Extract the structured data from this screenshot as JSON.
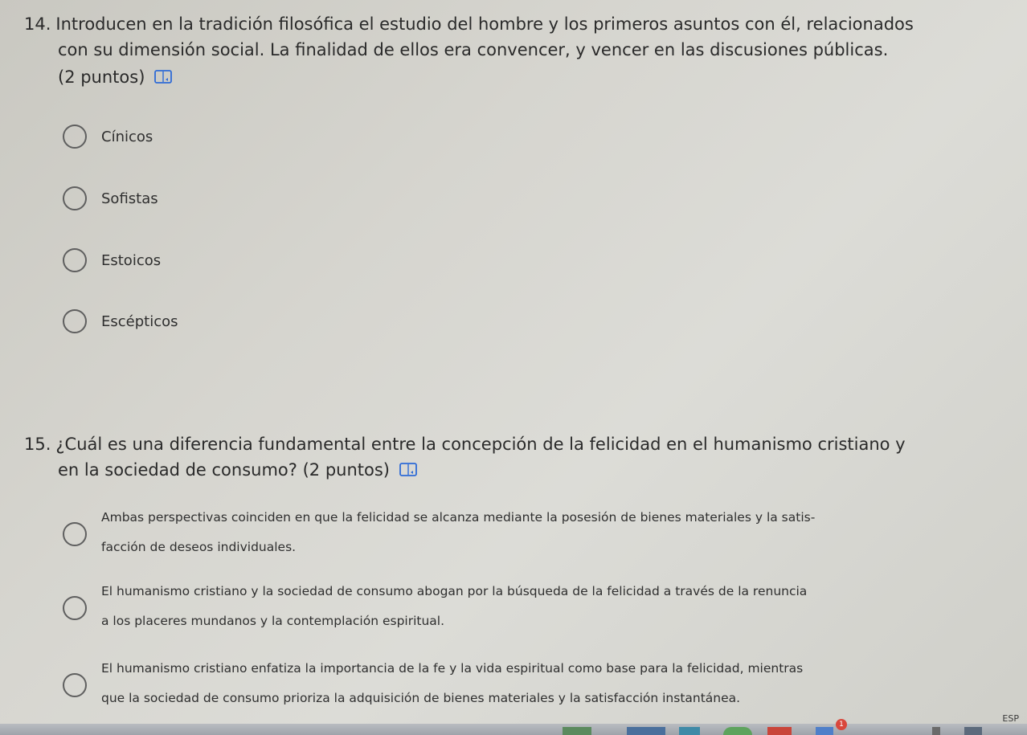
{
  "q14": {
    "number": "14.",
    "line1": "Introducen en la tradición filosófica el estudio del hombre y los primeros asuntos con él, relacionados",
    "line2": "con su dimensión social. La finalidad de ellos era convencer, y vencer en las discusiones públicas.",
    "points": "(2 puntos)",
    "options": [
      {
        "label": "Cínicos"
      },
      {
        "label": "Sofistas"
      },
      {
        "label": "Estoicos"
      },
      {
        "label": "Escépticos"
      }
    ]
  },
  "q15": {
    "number": "15.",
    "line1": "¿Cuál es una diferencia fundamental entre la concepción de la felicidad en el humanismo cristiano y",
    "line2": "en la sociedad de consumo?",
    "points": "(2 puntos)",
    "options": [
      {
        "line1": "Ambas perspectivas coinciden en que la felicidad se alcanza mediante la posesión de bienes materiales y la satis-",
        "line2": "facción de deseos individuales."
      },
      {
        "line1": "El humanismo cristiano y la sociedad de consumo abogan por la búsqueda de la felicidad a través de la renuncia",
        "line2": "a los placeres mundanos y la contemplación espiritual."
      },
      {
        "line1": "El humanismo cristiano enfatiza la importancia de la fe y la vida espiritual como base para la felicidad, mientras",
        "line2": "que la sociedad de consumo prioriza la adquisición de bienes materiales y la satisfacción instantánea."
      }
    ]
  },
  "taskbar": {
    "language": "ESP",
    "notification_count": "1"
  },
  "colors": {
    "text": "#2b2b2b",
    "radio_border": "#5f5f5f",
    "icon_blue": "#2e6bd6",
    "badge": "#d9473c"
  }
}
